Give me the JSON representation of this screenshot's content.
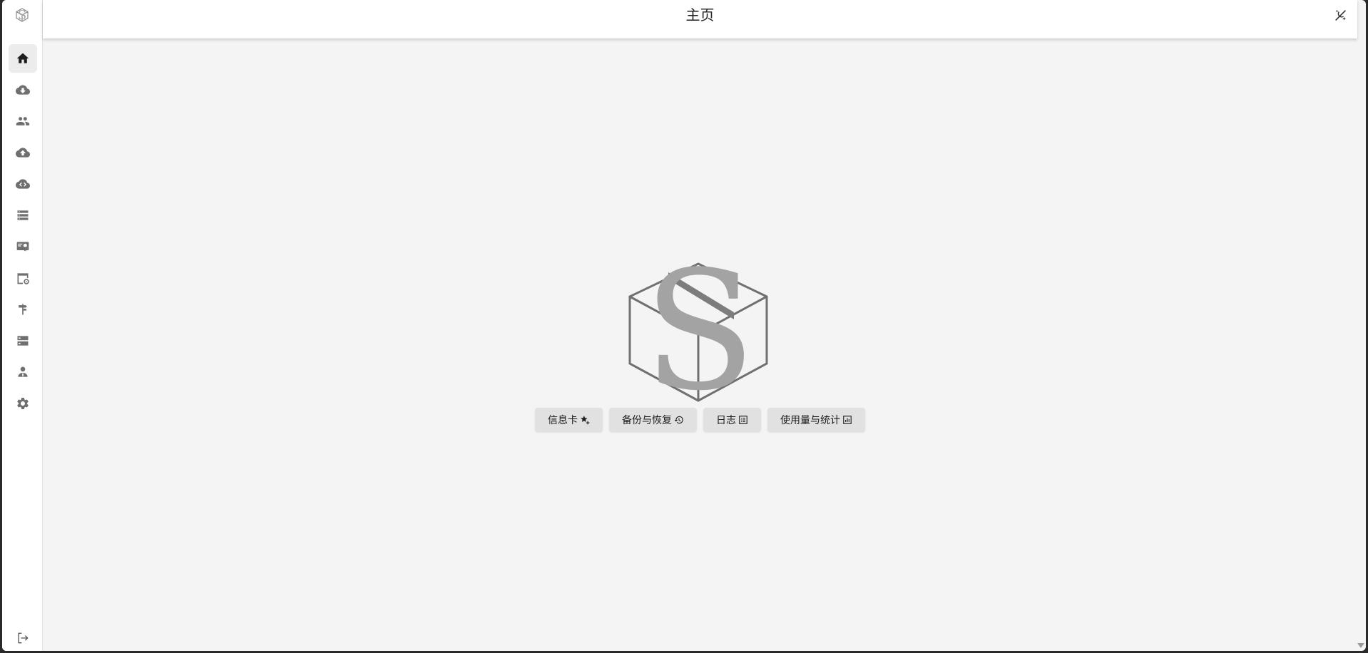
{
  "header": {
    "title": "主页"
  },
  "sidebar": {
    "logo_icon": "sbox-logo-icon",
    "items": [
      {
        "name": "home",
        "icon": "home-icon",
        "active": true
      },
      {
        "name": "download",
        "icon": "cloud-download-icon"
      },
      {
        "name": "users",
        "icon": "users-icon"
      },
      {
        "name": "upload",
        "icon": "cloud-upload-icon"
      },
      {
        "name": "cloud-code",
        "icon": "cloud-code-icon"
      },
      {
        "name": "list",
        "icon": "list-icon"
      },
      {
        "name": "certificate",
        "icon": "certificate-icon"
      },
      {
        "name": "web-settings",
        "icon": "browser-settings-icon"
      },
      {
        "name": "routing",
        "icon": "signpost-icon"
      },
      {
        "name": "servers",
        "icon": "server-icon"
      },
      {
        "name": "admin",
        "icon": "admin-user-icon"
      },
      {
        "name": "settings",
        "icon": "gear-icon"
      }
    ],
    "logout_icon": "logout-icon"
  },
  "actions": [
    {
      "label": "信息卡",
      "icon": "star-plus-icon"
    },
    {
      "label": "备份与恢复",
      "icon": "restore-icon"
    },
    {
      "label": "日志",
      "icon": "log-list-icon"
    },
    {
      "label": "使用量与统计",
      "icon": "chart-box-icon"
    }
  ],
  "colors": {
    "background": "#f4f4f4",
    "sidebar": "#ffffff",
    "button_bg": "#e1e1e1",
    "icon": "#6f6f6f",
    "logo_gray": "#a3a3a3"
  }
}
